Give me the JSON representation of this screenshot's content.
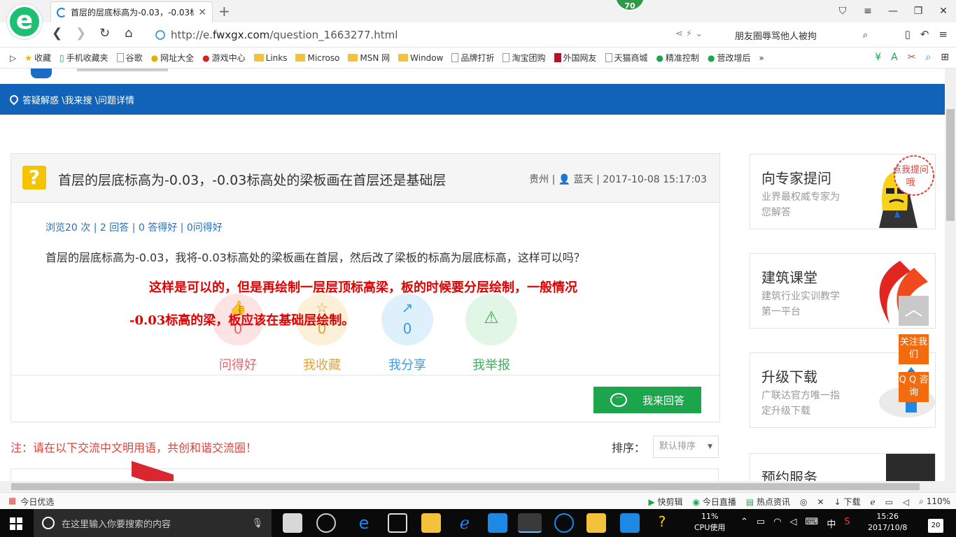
{
  "browser": {
    "tab_title": "首层的层底标高为-0.03，-0.03标",
    "badge": "70",
    "url_prefix": "http://e.",
    "url_domain": "fwxgx.com",
    "url_path": "/question_1663277.html",
    "search_text": "朋友圈辱骂他人被拘"
  },
  "bookmarks": [
    {
      "label": "收藏",
      "icon": "star-icon"
    },
    {
      "label": "手机收藏夹",
      "icon": "phone-icon"
    },
    {
      "label": "谷歌",
      "icon": "page-icon"
    },
    {
      "label": "网址大全",
      "icon": "globe-icon"
    },
    {
      "label": "游戏中心",
      "icon": "game-icon"
    },
    {
      "label": "Links",
      "icon": "folder-icon"
    },
    {
      "label": "Microso",
      "icon": "folder-icon"
    },
    {
      "label": "MSN 网",
      "icon": "folder-icon"
    },
    {
      "label": "Window",
      "icon": "folder-icon"
    },
    {
      "label": "品牌打折",
      "icon": "page-icon"
    },
    {
      "label": "淘宝团购",
      "icon": "page-icon"
    },
    {
      "label": "外国网友",
      "icon": "page-icon"
    },
    {
      "label": "天猫商城",
      "icon": "page-icon"
    },
    {
      "label": "精准控制",
      "icon": "wechat-icon"
    },
    {
      "label": "营改增后",
      "icon": "wechat-icon"
    }
  ],
  "breadcrumb": "答疑解惑 \\我来搜 \\问题详情",
  "question": {
    "title": "首层的层底标高为-0.03，-0.03标高处的梁板画在首层还是基础层",
    "location": "贵州",
    "user": "蓝天",
    "time": "2017-10-08 15:17:03",
    "stats": "浏览20 次 | 2 回答 | 0 答得好 | 0问得好",
    "body": "首层的层底标高为-0.03，我将-0.03标高处的梁板画在首层，然后改了梁板的标高为层底标高，这样可以吗？",
    "overlay_line1": "这样是可以的，但是再绘制一层层顶标高梁，板的时候要分层绘制，一般情况",
    "overlay_line2": "-0.03标高的梁，板应该在基础层绘制。"
  },
  "actions": [
    {
      "label": "问得好",
      "count": "0",
      "color": "#e06a70",
      "bg": "#fde3e4",
      "icon": "👍"
    },
    {
      "label": "我收藏",
      "count": "0",
      "color": "#e3a33a",
      "bg": "#fdf0d9",
      "icon": "☆"
    },
    {
      "label": "我分享",
      "count": "0",
      "color": "#3b9be0",
      "bg": "#dff0fd",
      "icon": "↗"
    },
    {
      "label": "我举报",
      "count": "",
      "color": "#3fae5a",
      "bg": "#e2f6e6",
      "icon": "⚠"
    }
  ],
  "answer_button": "我来回答",
  "note": "注：请在以下交流中文明用语，共创和谐交流圈！",
  "sort_label": "排序：",
  "sort_value": "默认排序",
  "sidebar": [
    {
      "title": "向专家提问",
      "sub": "业界最权威专家为您解答",
      "bubble": "点我提问哦"
    },
    {
      "title": "建筑课堂",
      "sub": "建筑行业实训教学第一平台"
    },
    {
      "title": "升级下载",
      "sub": "广联达官方唯一指定升级下载"
    },
    {
      "title": "预约服务",
      "sub": ""
    }
  ],
  "float_follow": "关注我们",
  "float_qq": "Q Q 咨询",
  "status": {
    "left": "今日优选",
    "items": [
      "快剪辑",
      "今日直播",
      "热点资讯",
      "下载",
      "110%"
    ]
  },
  "taskbar": {
    "search_placeholder": "在这里输入你要搜索的内容",
    "cpu_value": "11%",
    "cpu_label": "CPU使用",
    "ime": "中",
    "time": "15:26",
    "date": "2017/10/8",
    "notifications": "20"
  }
}
